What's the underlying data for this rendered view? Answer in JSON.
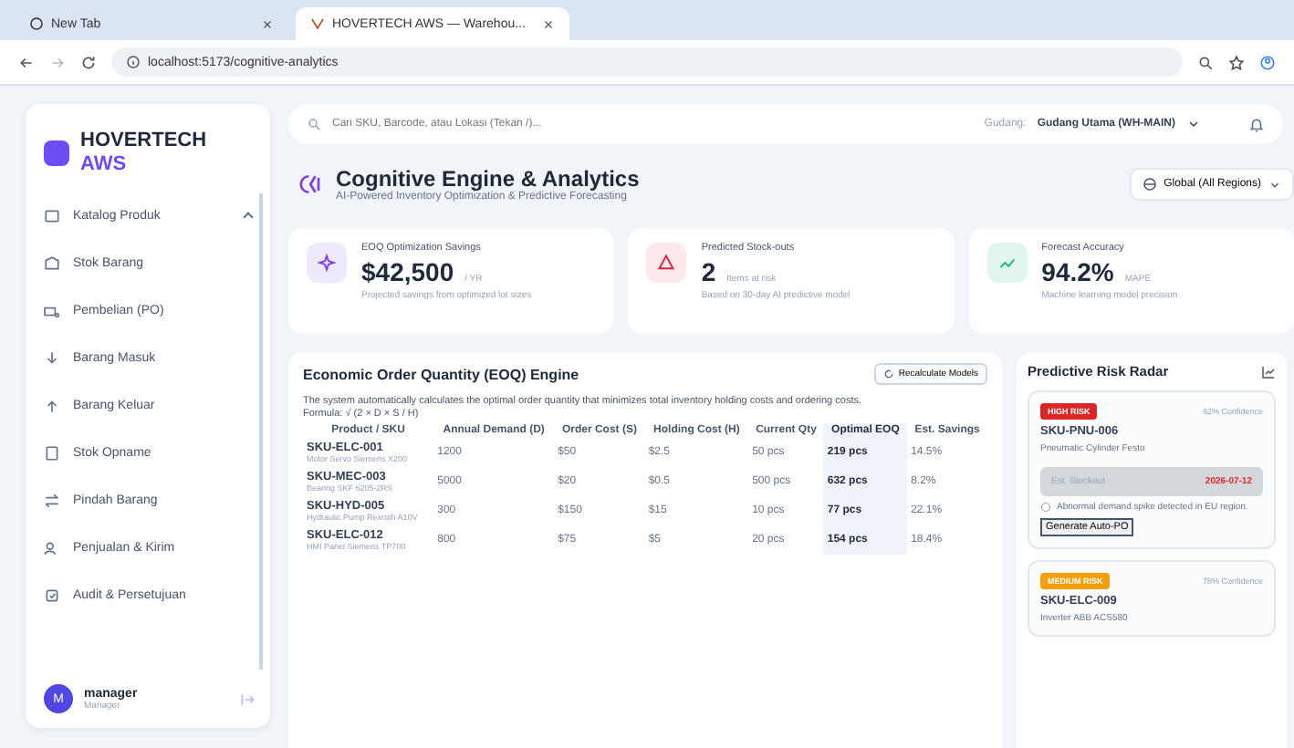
{
  "browser": {
    "tabs": [
      {
        "title": "New Tab",
        "selected": false
      },
      {
        "title": "HOVERTECH AWS — Warehou...",
        "selected": true
      }
    ],
    "url": "localhost:5173/cognitive-analytics"
  },
  "sidebar": {
    "brand": "HOVERTECH",
    "brand_sub": "AWS",
    "items": [
      {
        "label": "Katalog Produk",
        "expanded": true
      },
      {
        "label": "Stok Barang",
        "expanded": false
      },
      {
        "label": "Pembelian (PO)",
        "expanded": false
      },
      {
        "label": "Barang Masuk",
        "expanded": false
      },
      {
        "label": "Barang Keluar",
        "expanded": false
      },
      {
        "label": "Stok Opname",
        "expanded": false
      },
      {
        "label": "Pindah Barang",
        "expanded": false
      },
      {
        "label": "Penjualan & Kirim",
        "expanded": false
      },
      {
        "label": "Audit & Persetujuan",
        "expanded": false
      }
    ],
    "user": {
      "initial": "M",
      "name": "manager",
      "role": "Manager"
    }
  },
  "topbar": {
    "search": {
      "placeholder": "Cari SKU, Barcode, atau Lokasi (Tekan /)..."
    },
    "warehouse_label": "Gudang:",
    "warehouse": "Gudang Utama (WH-MAIN)"
  },
  "header": {
    "title": "Cognitive Engine & Analytics",
    "subtitle": "AI-Powered Inventory Optimization & Predictive Forecasting",
    "region": "Global (All Regions)"
  },
  "cards": [
    {
      "kind": "savings",
      "label": "EOQ Optimization Savings",
      "value": "$42,500",
      "unit": "/ YR",
      "note": "Projected savings from optimized lot sizes"
    },
    {
      "kind": "risk",
      "label": "Predicted Stock-outs",
      "value": "2",
      "unit": "Items at risk",
      "note": "Based on 30-day AI predictive model"
    },
    {
      "kind": "accuracy",
      "label": "Forecast Accuracy",
      "value": "94.2%",
      "unit": "MAPE",
      "note": "Machine learning model precision"
    }
  ],
  "eoq": {
    "title": "Economic Order Quantity (EOQ) Engine",
    "button": "Recalculate Models",
    "description": "The system automatically calculates the optimal order quantity that minimizes total inventory holding costs and ordering costs.",
    "formula": "Formula: √ (2 × D × S / H)",
    "columns": [
      "Product / SKU",
      "Annual Demand (D)",
      "Order Cost (S)",
      "Holding Cost (H)",
      "Current Qty",
      "Optimal EOQ",
      "Est. Savings"
    ],
    "rows": [
      {
        "name": "Motor Servo Siemens X200",
        "cells": [
          "SKU-ELC-001",
          "1200",
          "$50",
          "$2.5",
          "50 pcs",
          "219 pcs",
          "14.5%"
        ]
      },
      {
        "name": "Bearing SKF 6205-2RS",
        "cells": [
          "SKU-MEC-003",
          "5000",
          "$20",
          "$0.5",
          "500 pcs",
          "632 pcs",
          "8.2%"
        ]
      },
      {
        "name": "Hydraulic Pump Rexroth A10V",
        "cells": [
          "SKU-HYD-005",
          "300",
          "$150",
          "$15",
          "10 pcs",
          "77 pcs",
          "22.1%"
        ]
      },
      {
        "name": "HMI Panel Siemens TP700",
        "cells": [
          "SKU-ELC-012",
          "800",
          "$75",
          "$5",
          "20 pcs",
          "154 pcs",
          "18.4%"
        ]
      }
    ]
  },
  "radar": {
    "title": "Predictive Risk Radar",
    "items": [
      {
        "level": "HIGH RISK",
        "color": "#dc2626",
        "confidence": "92% Confidence",
        "sku": "SKU-PNU-006",
        "name": "Pneumatic Cylinder Festo",
        "eta_label": "Est. Stockout",
        "eta": "2026-07-12",
        "alert": "Abnormal demand spike detected in EU region.",
        "action": "Generate Auto-PO"
      },
      {
        "level": "MEDIUM RISK",
        "color": "#f59e0b",
        "confidence": "78% Confidence",
        "sku": "SKU-ELC-009",
        "name": "Inverter ABB ACS580"
      }
    ]
  }
}
